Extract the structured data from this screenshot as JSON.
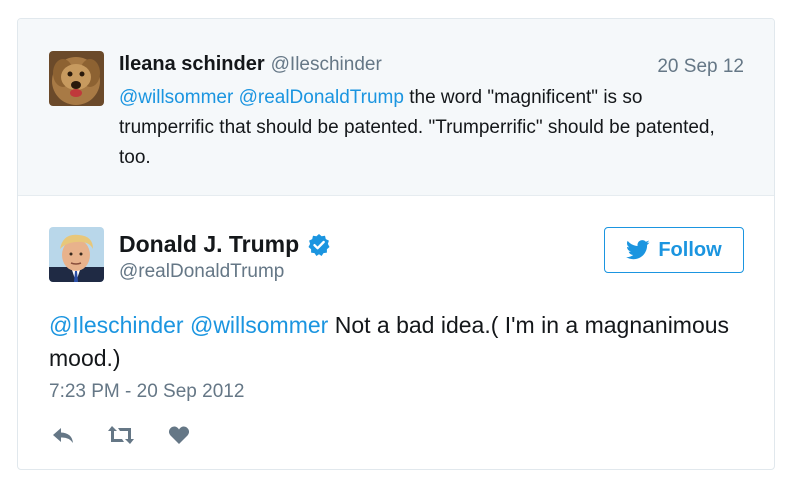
{
  "parent_tweet": {
    "name": "Ileana schinder",
    "handle": "@Ileschinder",
    "date": "20 Sep 12",
    "mention_1": "@willsommer",
    "mention_2": "@realDonaldTrump",
    "text": " the word \"magnificent\" is so trumperrific that should be patented. \"Trumperrific\" should be patented, too."
  },
  "tweet": {
    "name": "Donald J. Trump",
    "handle": "@realDonaldTrump",
    "follow_label": "Follow",
    "mention_1": "@Ileschinder",
    "mention_2": "@willsommer",
    "text": " Not a bad idea.( I'm in a magnanimous mood.)",
    "timestamp": "7:23 PM - 20 Sep 2012"
  },
  "colors": {
    "link": "#1b95e0",
    "secondary_text": "#657786",
    "action_icon": "#657786"
  },
  "icons": [
    "dog-avatar",
    "trump-avatar",
    "verified-badge-icon",
    "twitter-bird-icon",
    "reply-icon",
    "retweet-icon",
    "like-heart-icon"
  ]
}
